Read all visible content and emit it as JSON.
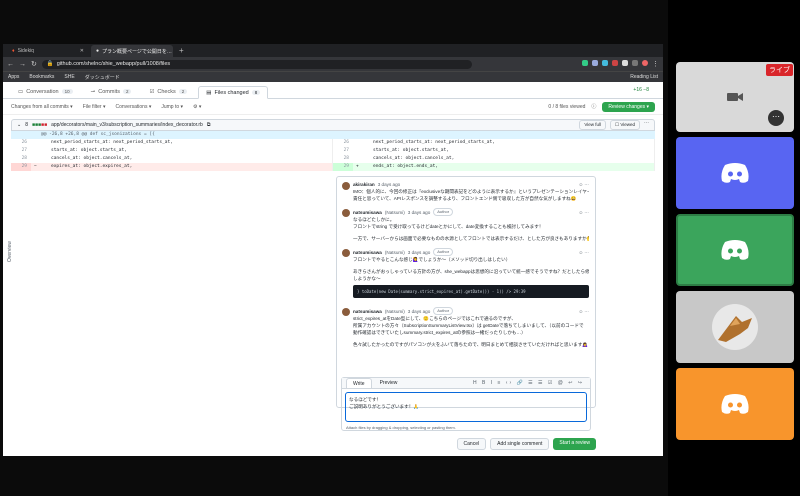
{
  "browser": {
    "tabs": [
      {
        "label": "Sidekiq",
        "active": false
      },
      {
        "label": "プラン概要ページで公開日を…",
        "active": true
      }
    ],
    "url": "github.com/shelnc/shie_webapp/pull/1008/files",
    "bookmarks": [
      "Apps",
      "Bookmarks",
      "SHE",
      "ダッシュボード"
    ],
    "reading_list": "Reading List"
  },
  "pr": {
    "tabs": [
      {
        "label": "Conversation",
        "count": "10"
      },
      {
        "label": "Commits",
        "count": "2"
      },
      {
        "label": "Checks",
        "count": "2"
      },
      {
        "label": "Files changed",
        "count": "8"
      }
    ],
    "diffstat": "+16 −8",
    "toolbar": {
      "changes_from": "Changes from all commits ▾",
      "file_filter": "File filter ▾",
      "conversations": "Conversations ▾",
      "jump_to": "Jump to ▾",
      "settings": "⚙ ▾",
      "files_viewed": "0 / 8 files viewed",
      "review_button": "Review changes ▾"
    }
  },
  "file": {
    "changes": "8",
    "path": "app/decorators/main_v3/subscription_summaries/index_decorator.rb",
    "view_full": "View full",
    "viewed": "Viewed",
    "hunk": "@@ -26,8 +26,8 @@ def sc_jsonizations = [{",
    "left_lines": [
      {
        "ln": "26",
        "code": "next_period_starts_at: next_period_starts_at,",
        "type": ""
      },
      {
        "ln": "27",
        "code": "starts_at: object.starts_at,",
        "type": ""
      },
      {
        "ln": "28",
        "code": "cancels_at: object.cancels_at,",
        "type": ""
      },
      {
        "ln": "29",
        "code": "expires_at: object.expires_at,",
        "type": "del",
        "sign": "−"
      }
    ],
    "right_lines": [
      {
        "ln": "26",
        "code": "next_period_starts_at: next_period_starts_at,",
        "type": ""
      },
      {
        "ln": "27",
        "code": "starts_at: object.starts_at,",
        "type": ""
      },
      {
        "ln": "28",
        "code": "cancels_at: object.cancels_at,",
        "type": ""
      },
      {
        "ln": "29",
        "code": "ends_at: object.ends_at,",
        "type": "add",
        "sign": "+"
      }
    ]
  },
  "overview_label": "Overview",
  "thread": {
    "comments": [
      {
        "author": "akirakiran",
        "time": "3 days ago",
        "badge": "",
        "lines": [
          "IMO：個人的に、今回の修正は『exclusiveな期間表記をどのように表示するか』というプレゼンテーションレイヤーの",
          "責任と思っていて、APIレスポンスを調整するより、フロントエンド側で吸収した方が自然な気がしますね😄"
        ]
      },
      {
        "author": "natsumisawa",
        "handle": "(Natsumi)",
        "time": "3 days ago",
        "badge": "Author",
        "lines": [
          "なるほどたしかに。",
          "フロントでstring で受け取ってるけどdateとかにして、date変換することも検討してみます！",
          "",
          "一方で、サーバーからは画面で必要なものの水源としてフロントでは表示するだけ、とした方が良さもありますか🤔"
        ]
      },
      {
        "author": "natsumisawa",
        "handle": "(Natsumi)",
        "time": "3 days ago",
        "badge": "Author",
        "lines": [
          "フロントでやるとこんな感じ🙋‍♀️でしょうか〜（メソッド切り出しはしたい）",
          "",
          "あきらさんがおっしゃっている方針の方が、she_webappは思想的に沿っていて統一感でそうですね？だとしたら修正",
          "しようかな〜"
        ],
        "code": "} toDate(new Date(summary.strict_expires_at).getDate()) - 1)) /> 29:39"
      },
      {
        "author": "natsumisawa",
        "handle": "(Natsumi)",
        "time": "3 days ago",
        "badge": "Author",
        "lines": [
          "strict_expires_atをDate型にして、🙂こちらのページではこれで通るのですが、",
          "所属アカウントの方々（SubscriptionSummaryListView.tsx）は getDateで落ちてしまいまして、（以前のコードで",
          "動作確認はできていたしsummary.strict_expires_atの参照は一緒だったりしかも…）",
          "",
          "色々試したかったのですがパソコンが火をふいて落ちたので、明日まとめて相談させていただければと思います🙇‍♀️・・・😅"
        ]
      }
    ],
    "reply": {
      "write_tab": "Write",
      "preview_tab": "Preview",
      "toolbar": "H B I ≡ ‹› 🔗 ☰ ☰ ☑ @ ↩ ↪",
      "text": "なるほどです！\nご説明ありがとうございます！🙏",
      "attach": "Attach files by dragging & dropping, selecting or pasting them."
    },
    "actions": {
      "cancel": "Cancel",
      "single": "Add single comment",
      "review": "Start a review"
    }
  },
  "call": {
    "live_label": "ライブ",
    "tiles": [
      {
        "kind": "camera-off",
        "color": "#d9d9d9"
      },
      {
        "kind": "discord",
        "color": "#5865f2"
      },
      {
        "kind": "discord",
        "color": "#3ba55c"
      },
      {
        "kind": "cat",
        "color": "#e8e8e8"
      },
      {
        "kind": "discord",
        "color": "#f8952c"
      }
    ]
  }
}
